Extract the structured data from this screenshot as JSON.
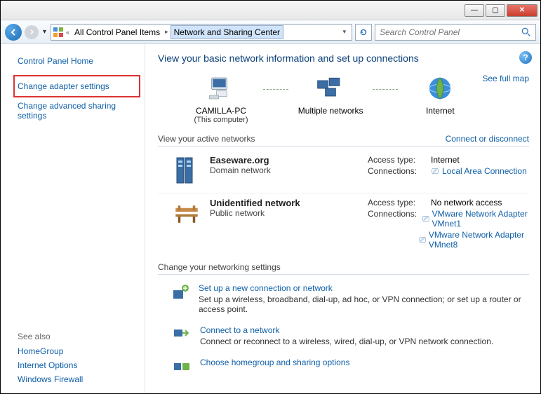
{
  "titlebar": {
    "min": "—",
    "max": "▢",
    "close": "✕"
  },
  "nav": {
    "breadcrumb_sep": "«",
    "crumb1": "All Control Panel Items",
    "crumb2": "Network and Sharing Center",
    "search_placeholder": "Search Control Panel"
  },
  "left": {
    "home": "Control Panel Home",
    "adapter": "Change adapter settings",
    "advanced": "Change advanced sharing settings",
    "see_also": "See also",
    "homegroup": "HomeGroup",
    "inet_opts": "Internet Options",
    "firewall": "Windows Firewall"
  },
  "main": {
    "title": "View your basic network information and set up connections",
    "fullmap": "See full map",
    "map": {
      "pc_name": "CAMILLA-PC",
      "pc_sub": "(This computer)",
      "multi": "Multiple networks",
      "internet": "Internet"
    },
    "active_head": "View your active networks",
    "connect_link": "Connect or disconnect",
    "net1": {
      "name": "Easeware.org",
      "type": "Domain network",
      "access_k": "Access type:",
      "access_v": "Internet",
      "conn_k": "Connections:",
      "conn_v": "Local Area Connection"
    },
    "net2": {
      "name": "Unidentified network",
      "type": "Public network",
      "access_k": "Access type:",
      "access_v": "No network access",
      "conn_k": "Connections:",
      "conn_v1": "VMware Network Adapter VMnet1",
      "conn_v2": "VMware Network Adapter VMnet8"
    },
    "settings_head": "Change your networking settings",
    "s1": {
      "title": "Set up a new connection or network",
      "desc": "Set up a wireless, broadband, dial-up, ad hoc, or VPN connection; or set up a router or access point."
    },
    "s2": {
      "title": "Connect to a network",
      "desc": "Connect or reconnect to a wireless, wired, dial-up, or VPN network connection."
    },
    "s3": {
      "title": "Choose homegroup and sharing options"
    }
  }
}
